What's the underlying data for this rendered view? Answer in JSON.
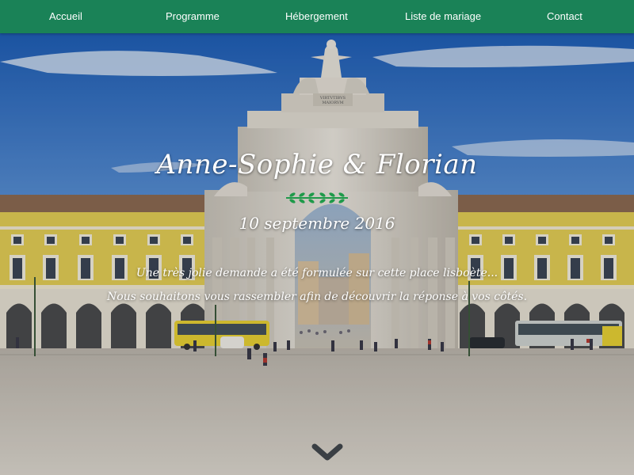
{
  "nav": {
    "items": [
      {
        "label": "Accueil"
      },
      {
        "label": "Programme"
      },
      {
        "label": "Hébergement"
      },
      {
        "label": "Liste de mariage"
      },
      {
        "label": "Contact"
      }
    ]
  },
  "hero": {
    "title": "Anne-Sophie & Florian",
    "date": "10 septembre 2016",
    "line1": "Une très jolie demande a été formulée sur cette place lisboète...",
    "line2": "Nous souhaitons vous rassembler afin de découvrir la réponse à vos côtés.",
    "arch_inscription_1": "VIRTVTIBVS",
    "arch_inscription_2": "MAIORVM"
  },
  "colors": {
    "nav_bg": "#1a8257",
    "accent_green": "#1f9a4a",
    "sky": "#2f6fc1",
    "facade_yellow": "#e8d35a"
  },
  "icons": {
    "scroll_down": "chevron-down-icon",
    "ornament": "laurel-icon"
  }
}
